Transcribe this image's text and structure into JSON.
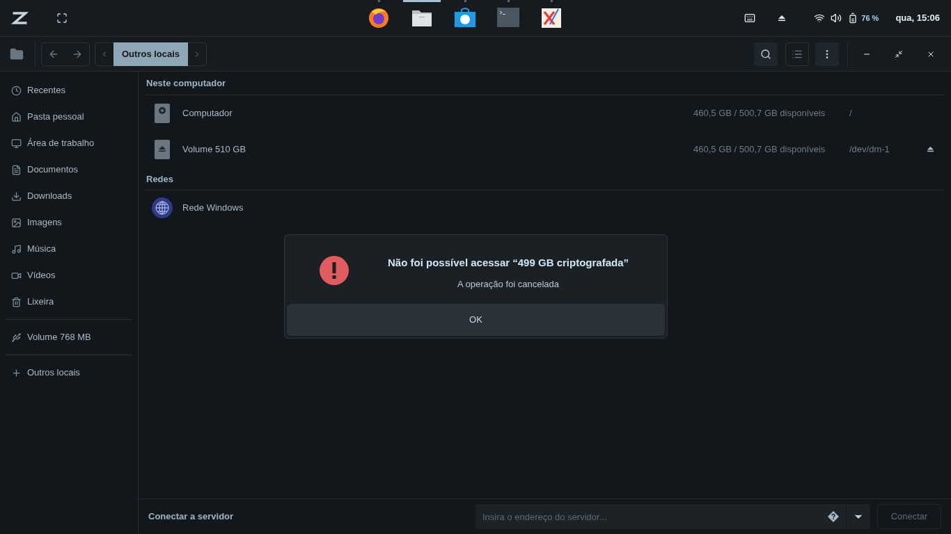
{
  "top_bar": {
    "dock": [
      {
        "kind": "browser",
        "active": false
      },
      {
        "kind": "files",
        "active": true
      },
      {
        "kind": "store",
        "active": false
      },
      {
        "kind": "terminal",
        "active": false
      },
      {
        "kind": "editor",
        "active": false
      }
    ],
    "battery": "76 %",
    "clock": "qua, 15:06"
  },
  "toolbar": {
    "path": [
      {
        "label": "Outros locais",
        "selected": true
      }
    ]
  },
  "sidebar": {
    "groups": [
      [
        {
          "label": "Recentes"
        },
        {
          "label": "Pasta pessoal"
        },
        {
          "label": "Área de trabalho"
        },
        {
          "label": "Documentos"
        },
        {
          "label": "Downloads"
        },
        {
          "label": "Imagens"
        },
        {
          "label": "Música"
        },
        {
          "label": "Vídeos"
        },
        {
          "label": "Lixeira"
        }
      ],
      [
        {
          "label": "Volume 768 MB"
        }
      ],
      [
        {
          "label": "Outros locais"
        }
      ]
    ]
  },
  "sections": [
    {
      "title": "Neste computador",
      "items": [
        {
          "kind": "drive",
          "name": "Computador",
          "space": "460,5 GB / 500,7 GB disponíveis",
          "mount": "/",
          "ejectable": false
        },
        {
          "kind": "volume",
          "name": "Volume 510 GB",
          "space": "460,5 GB / 500,7 GB disponíveis",
          "mount": "/dev/dm-1",
          "ejectable": true
        }
      ]
    },
    {
      "title": "Redes",
      "items": [
        {
          "kind": "network",
          "name": "Rede Windows"
        }
      ]
    }
  ],
  "dialog": {
    "title": "Não foi possível acessar “499 GB criptografada”",
    "message": "A operação foi cancelada",
    "button": "OK"
  },
  "connect_bar": {
    "label": "Conectar a servidor",
    "placeholder": "Insira o endereço do servidor...",
    "button": "Conectar",
    "button_disabled": true
  }
}
